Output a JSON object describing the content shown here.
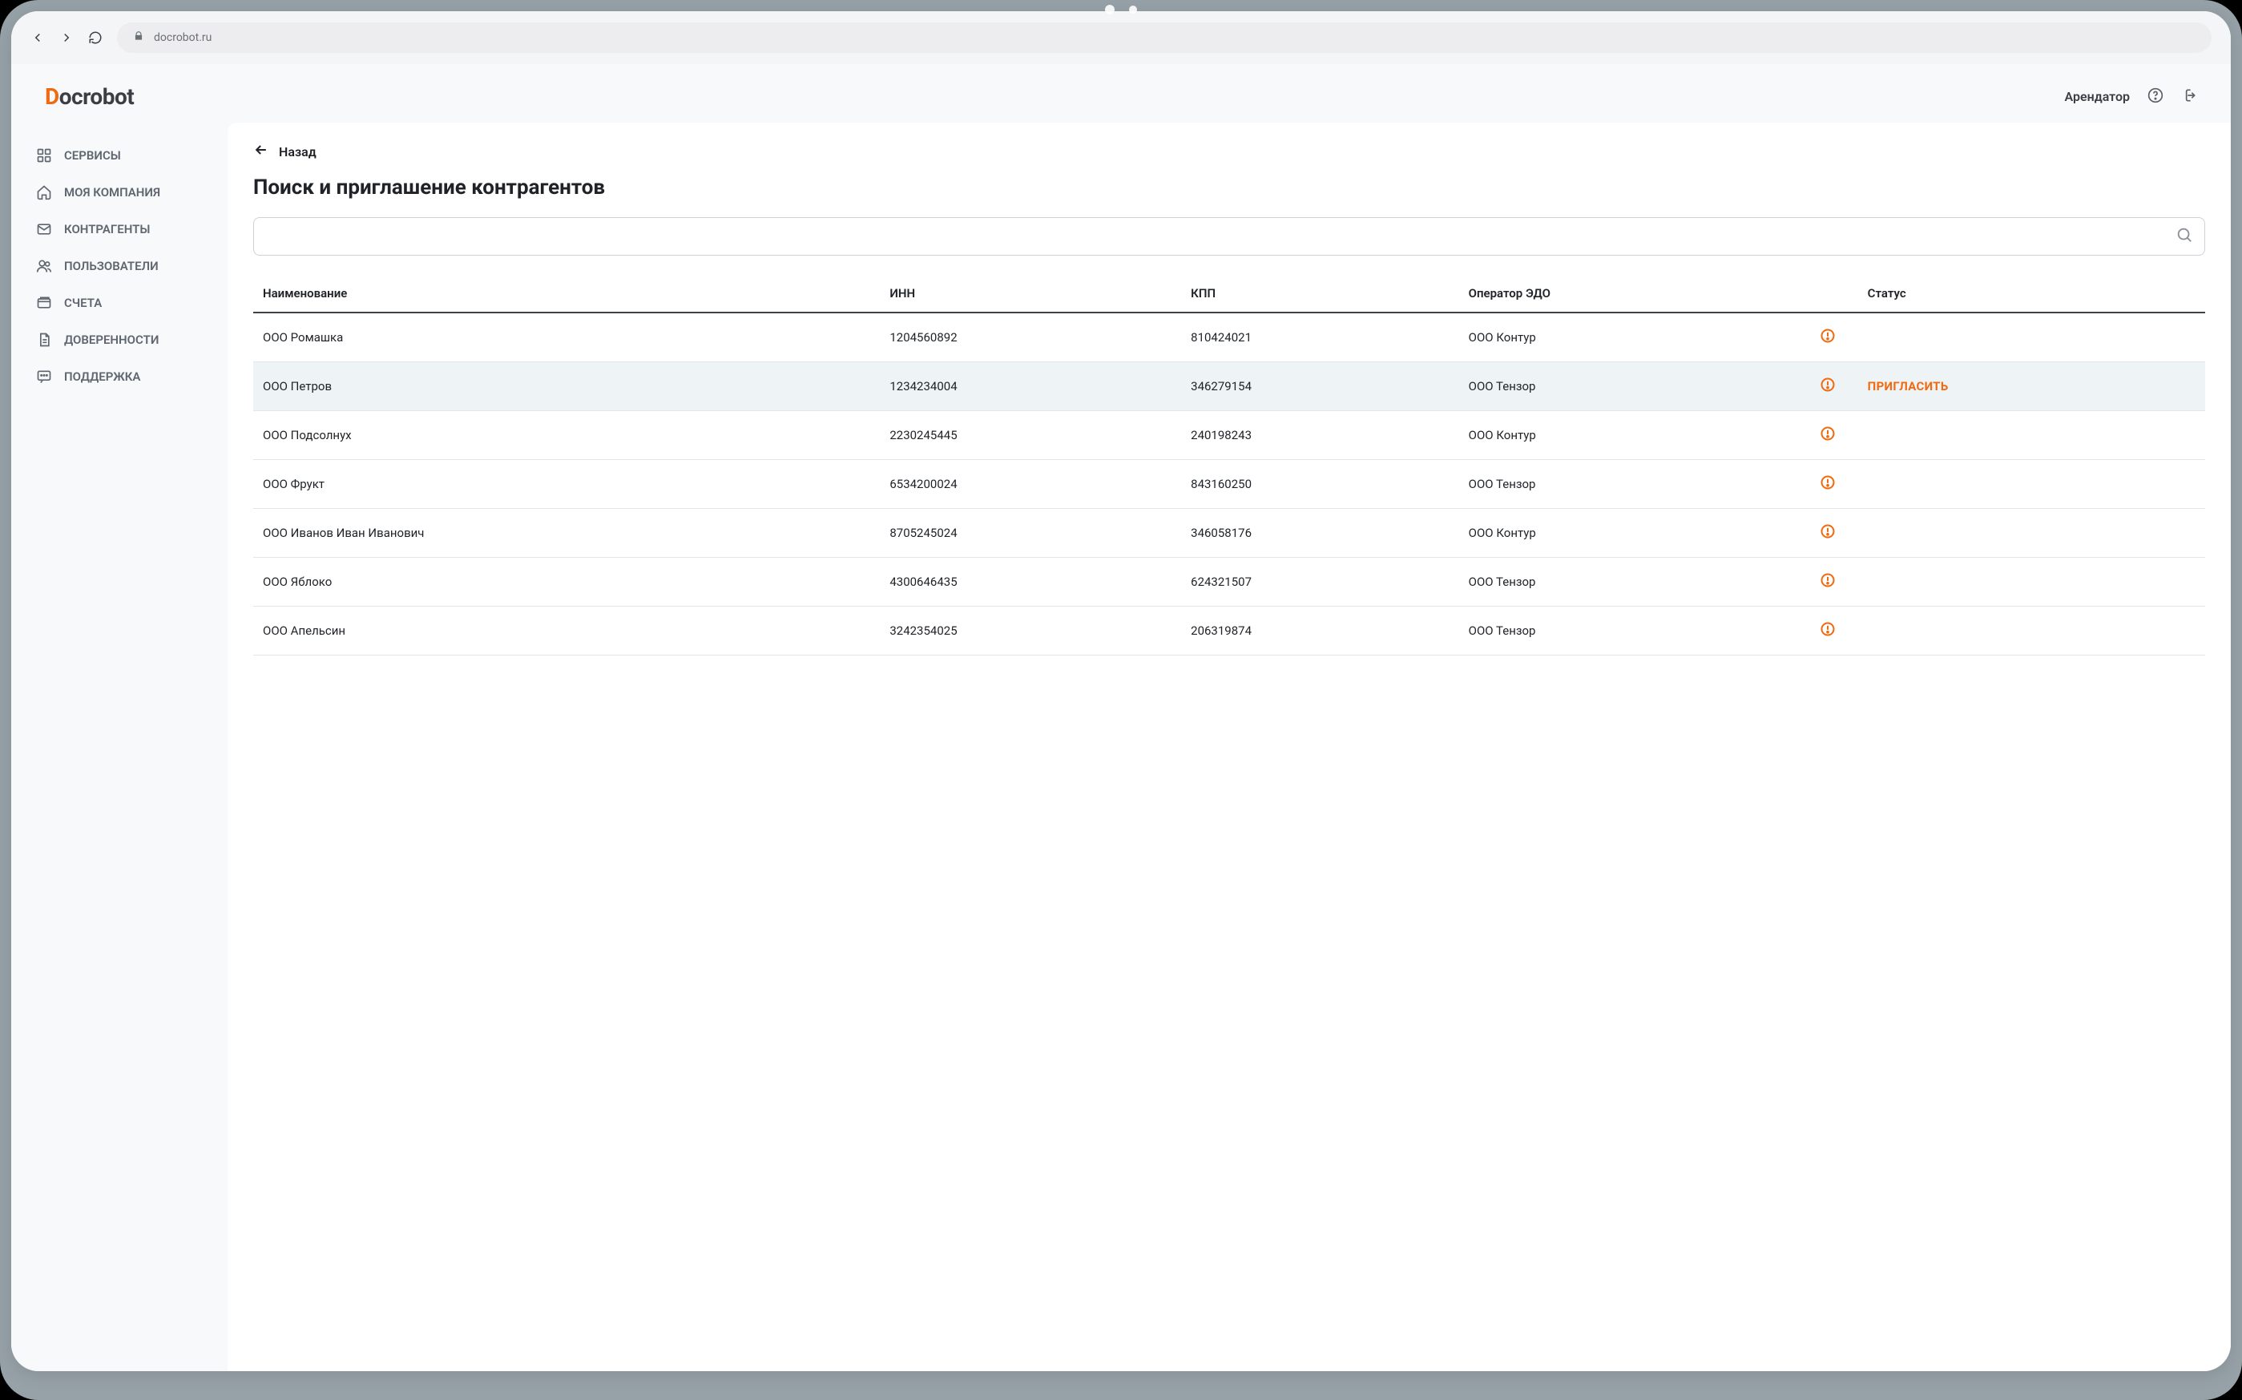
{
  "browser": {
    "url": "docrobot.ru"
  },
  "brand": {
    "name_prefix": "D",
    "name_rest": "ocrobot"
  },
  "topbar": {
    "tenant": "Арендатор"
  },
  "sidebar": {
    "items": [
      {
        "label": "СЕРВИСЫ",
        "icon": "grid-icon"
      },
      {
        "label": "МОЯ КОМПАНИЯ",
        "icon": "home-icon"
      },
      {
        "label": "КОНТРАГЕНТЫ",
        "icon": "mail-icon"
      },
      {
        "label": "ПОЛЬЗОВАТЕЛИ",
        "icon": "users-icon"
      },
      {
        "label": "СЧЕТА",
        "icon": "wallet-icon"
      },
      {
        "label": "ДОВЕРЕННОСТИ",
        "icon": "document-icon"
      },
      {
        "label": "ПОДДЕРЖКА",
        "icon": "chat-icon"
      }
    ]
  },
  "page": {
    "back_label": "Назад",
    "title": "Поиск и приглашение контрагентов",
    "search_value": ""
  },
  "table": {
    "columns": {
      "name": "Наименование",
      "inn": "ИНН",
      "kpp": "КПП",
      "operator": "Оператор ЭДО",
      "status": "Статус"
    },
    "invite_label": "ПРИГЛАСИТЬ",
    "rows": [
      {
        "name": "ООО Ромашка",
        "inn": "1204560892",
        "kpp": "810424021",
        "operator": "ООО Контур",
        "alert": true,
        "invite": false,
        "highlight": false
      },
      {
        "name": "ООО Петров",
        "inn": "1234234004",
        "kpp": "346279154",
        "operator": "ООО Тензор",
        "alert": true,
        "invite": true,
        "highlight": true
      },
      {
        "name": "ООО Подсолнух",
        "inn": "2230245445",
        "kpp": "240198243",
        "operator": "ООО Контур",
        "alert": true,
        "invite": false,
        "highlight": false
      },
      {
        "name": "ООО Фрукт",
        "inn": "6534200024",
        "kpp": "843160250",
        "operator": "ООО Тензор",
        "alert": true,
        "invite": false,
        "highlight": false
      },
      {
        "name": "ООО Иванов Иван Иванович",
        "inn": "8705245024",
        "kpp": "346058176",
        "operator": "ООО Контур",
        "alert": true,
        "invite": false,
        "highlight": false
      },
      {
        "name": "ООО Яблоко",
        "inn": "4300646435",
        "kpp": "624321507",
        "operator": "ООО Тензор",
        "alert": true,
        "invite": false,
        "highlight": false
      },
      {
        "name": "ООО Апельсин",
        "inn": "3242354025",
        "kpp": "206319874",
        "operator": "ООО Тензор",
        "alert": true,
        "invite": false,
        "highlight": false
      }
    ]
  },
  "colors": {
    "accent": "#f06a10",
    "text": "#1f2227",
    "muted": "#5f6670",
    "border": "#e2e6ea"
  }
}
